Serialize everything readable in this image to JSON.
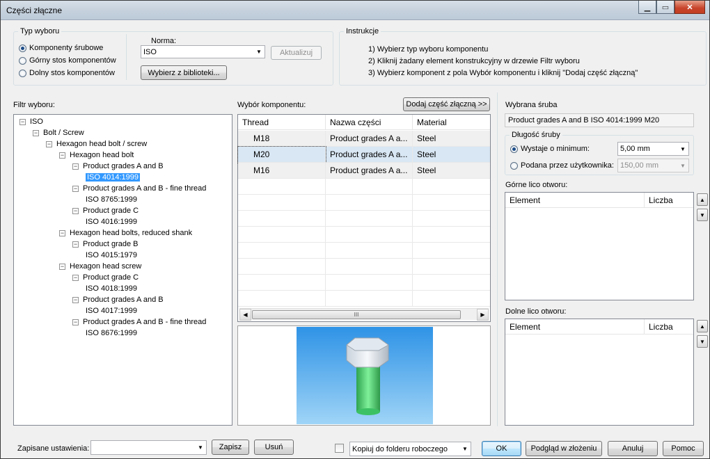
{
  "window": {
    "title": "Części złączne"
  },
  "selection_type": {
    "legend": "Typ wyboru",
    "options": [
      {
        "label": "Komponenty śrubowe",
        "selected": true
      },
      {
        "label": "Górny stos komponentów",
        "selected": false
      },
      {
        "label": "Dolny stos komponentów",
        "selected": false
      }
    ],
    "norma_label": "Norma:",
    "norma_value": "ISO",
    "update_button": "Aktualizuj",
    "library_button": "Wybierz z biblioteki..."
  },
  "instructions": {
    "legend": "Instrukcje",
    "lines": [
      "1) Wybierz typ wyboru komponentu",
      "2) Kliknij żadany element konstrukcyjny w drzewie Filtr wyboru",
      "3) Wybierz komponent z pola Wybór komponentu i kliknij \"Dodaj część złączną\""
    ]
  },
  "filter": {
    "label": "Filtr wyboru:",
    "tree": [
      {
        "text": "ISO",
        "level": 0,
        "toggle": "−",
        "selected": false
      },
      {
        "text": "Bolt / Screw",
        "level": 1,
        "toggle": "−",
        "selected": false
      },
      {
        "text": "Hexagon head bolt / screw",
        "level": 2,
        "toggle": "−",
        "selected": false
      },
      {
        "text": "Hexagon head bolt",
        "level": 3,
        "toggle": "−",
        "selected": false
      },
      {
        "text": "Product grades A and B",
        "level": 4,
        "toggle": "−",
        "selected": false
      },
      {
        "text": "ISO 4014:1999",
        "level": 5,
        "toggle": "",
        "selected": true
      },
      {
        "text": "Product grades A and B - fine thread",
        "level": 4,
        "toggle": "−",
        "selected": false
      },
      {
        "text": "ISO 8765:1999",
        "level": 5,
        "toggle": "",
        "selected": false
      },
      {
        "text": "Product grade C",
        "level": 4,
        "toggle": "−",
        "selected": false
      },
      {
        "text": "ISO 4016:1999",
        "level": 5,
        "toggle": "",
        "selected": false
      },
      {
        "text": "Hexagon head bolts, reduced shank",
        "level": 3,
        "toggle": "−",
        "selected": false
      },
      {
        "text": "Product grade B",
        "level": 4,
        "toggle": "−",
        "selected": false
      },
      {
        "text": "ISO 4015:1979",
        "level": 5,
        "toggle": "",
        "selected": false
      },
      {
        "text": "Hexagon head screw",
        "level": 3,
        "toggle": "−",
        "selected": false
      },
      {
        "text": "Product grade C",
        "level": 4,
        "toggle": "−",
        "selected": false
      },
      {
        "text": "ISO 4018:1999",
        "level": 5,
        "toggle": "",
        "selected": false
      },
      {
        "text": "Product grades A and B",
        "level": 4,
        "toggle": "−",
        "selected": false
      },
      {
        "text": "ISO 4017:1999",
        "level": 5,
        "toggle": "",
        "selected": false
      },
      {
        "text": "Product grades A and B - fine thread",
        "level": 4,
        "toggle": "−",
        "selected": false
      },
      {
        "text": "ISO 8676:1999",
        "level": 5,
        "toggle": "",
        "selected": false
      }
    ]
  },
  "component": {
    "label": "Wybór komponentu:",
    "add_button": "Dodaj część złączną >>",
    "columns": [
      "Thread",
      "Nazwa części",
      "Material"
    ],
    "rows": [
      {
        "thread": "M18",
        "name": "Product grades A a...",
        "material": "Steel",
        "selected": false
      },
      {
        "thread": "M20",
        "name": "Product grades A a...",
        "material": "Steel",
        "selected": true
      },
      {
        "thread": "M16",
        "name": "Product grades A a...",
        "material": "Steel",
        "selected": false
      }
    ],
    "scroll_thumb_glyph": "III"
  },
  "selected_bolt": {
    "label": "Wybrana śruba",
    "value": "Product grades A and B ISO 4014:1999 M20",
    "length_legend": "Długość śruby",
    "option_min": "Wystaje o minimum:",
    "option_min_value": "5,00 mm",
    "option_user": "Podana przez użytkownika:",
    "option_user_value": "150,00 mm",
    "upper_label": "Górne lico otworu:",
    "lower_label": "Dolne lico otworu:",
    "col_element": "Element",
    "col_count": "Liczba"
  },
  "footer": {
    "saved_label": "Zapisane ustawienia:",
    "saved_value": "",
    "save_button": "Zapisz",
    "delete_button": "Usuń",
    "copy_option": "Kopiuj do folderu roboczego",
    "ok_button": "OK",
    "preview_button": "Podgląd w złożeniu",
    "cancel_button": "Anuluj",
    "help_button": "Pomoc"
  },
  "colors": {
    "selection": "#3399ff",
    "preview_sky": "#4aa8ea",
    "bolt_green": "#3ecf6a"
  }
}
